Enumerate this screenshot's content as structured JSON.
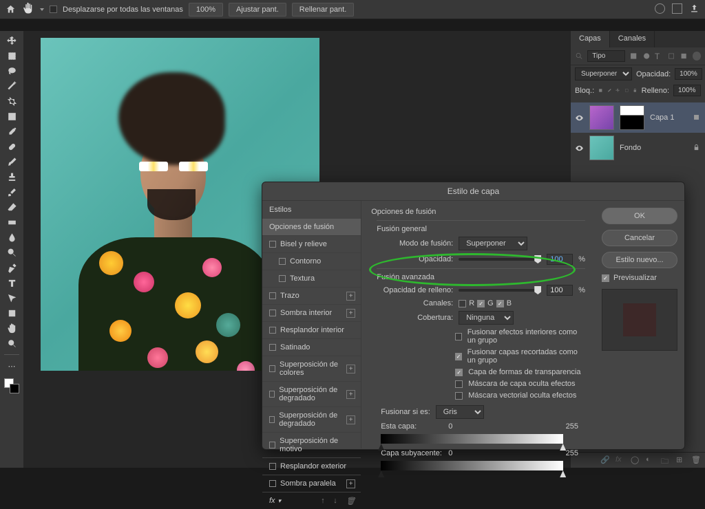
{
  "topbar": {
    "scroll_all": "Desplazarse por todas las ventanas",
    "zoom": "100%",
    "fit": "Ajustar pant.",
    "fill": "Rellenar pant."
  },
  "panels": {
    "tabs": {
      "layers": "Capas",
      "channels": "Canales"
    },
    "kind": "Tipo",
    "blend": "Superponer",
    "opacity_lbl": "Opacidad:",
    "opacity": "100%",
    "lock_lbl": "Bloq.:",
    "fill_lbl": "Relleno:",
    "fill": "100%"
  },
  "layers": {
    "l1": "Capa 1",
    "l2": "Fondo"
  },
  "dialog": {
    "title": "Estilo de capa",
    "left": {
      "styles": "Estilos",
      "blending": "Opciones de fusión",
      "bevel": "Bisel y relieve",
      "contour": "Contorno",
      "texture": "Textura",
      "stroke": "Trazo",
      "inner_shadow": "Sombra interior",
      "inner_glow": "Resplandor interior",
      "satin": "Satinado",
      "color_ov": "Superposición de colores",
      "grad_ov": "Superposición de degradado",
      "grad_ov2": "Superposición de degradado",
      "pat_ov": "Superposición de motivo",
      "outer_glow": "Resplandor exterior",
      "drop_shadow": "Sombra paralela",
      "fx": "fx"
    },
    "mid": {
      "options": "Opciones de fusión",
      "general": "Fusión general",
      "mode_lbl": "Modo de fusión:",
      "mode": "Superponer",
      "opacity_lbl": "Opacidad:",
      "opacity_val": "100",
      "pct": "%",
      "advanced": "Fusión avanzada",
      "fill_op_lbl": "Opacidad de relleno:",
      "fill_op_val": "100",
      "channels_lbl": "Canales:",
      "ch_r": "R",
      "ch_g": "G",
      "ch_b": "B",
      "knockout_lbl": "Cobertura:",
      "knockout": "Ninguna",
      "cb1": "Fusionar efectos interiores como un grupo",
      "cb2": "Fusionar capas recortadas como un grupo",
      "cb3": "Capa de formas de transparencia",
      "cb4": "Máscara de capa oculta efectos",
      "cb5": "Máscara vectorial oculta efectos",
      "blendif_lbl": "Fusionar si es:",
      "blendif": "Gris",
      "this_layer": "Esta capa:",
      "this_low": "0",
      "this_high": "255",
      "under_layer": "Capa subyacente:",
      "under_low": "0",
      "under_high": "255"
    },
    "right": {
      "ok": "OK",
      "cancel": "Cancelar",
      "new_style": "Estilo nuevo...",
      "preview": "Previsualizar"
    }
  }
}
